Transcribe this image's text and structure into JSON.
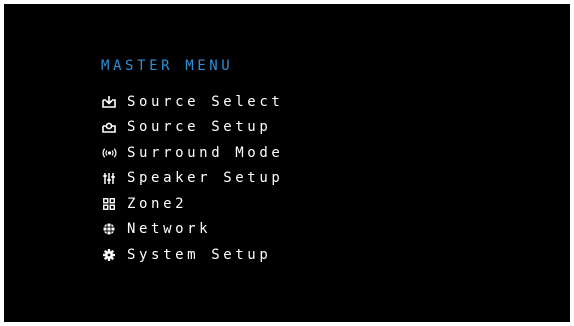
{
  "menu": {
    "title": "MASTER MENU",
    "items": [
      {
        "label": "Source Select",
        "icon": "source-select-icon"
      },
      {
        "label": "Source Setup",
        "icon": "source-setup-icon"
      },
      {
        "label": "Surround Mode",
        "icon": "surround-mode-icon"
      },
      {
        "label": "Speaker Setup",
        "icon": "speaker-setup-icon"
      },
      {
        "label": "Zone2",
        "icon": "zone2-icon"
      },
      {
        "label": "Network",
        "icon": "network-icon"
      },
      {
        "label": "System Setup",
        "icon": "system-setup-icon"
      }
    ]
  },
  "colors": {
    "background": "#000000",
    "title": "#2f8fd6",
    "text": "#ffffff"
  }
}
